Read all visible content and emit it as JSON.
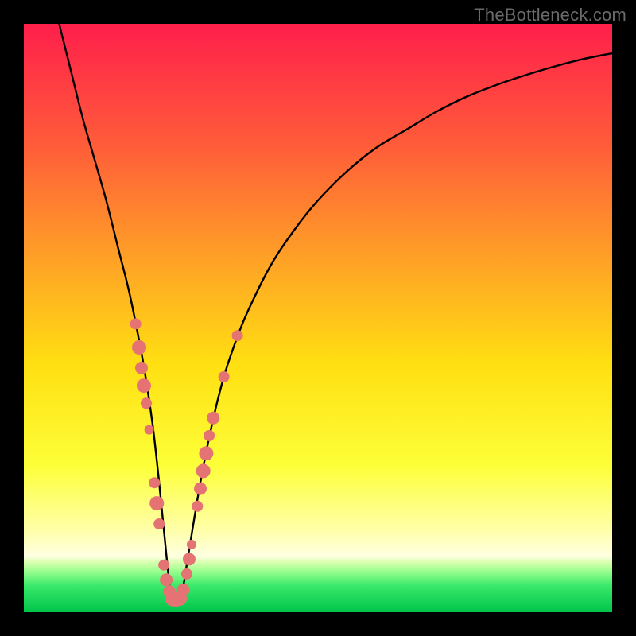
{
  "watermark": "TheBottleneck.com",
  "chart_data": {
    "type": "line",
    "title": "",
    "xlabel": "",
    "ylabel": "",
    "xlim": [
      0,
      100
    ],
    "ylim": [
      0,
      100
    ],
    "gradient_stops": [
      {
        "offset": 0.0,
        "color": "#ff1f4b"
      },
      {
        "offset": 0.2,
        "color": "#ff5a3a"
      },
      {
        "offset": 0.4,
        "color": "#ffa126"
      },
      {
        "offset": 0.58,
        "color": "#ffe012"
      },
      {
        "offset": 0.75,
        "color": "#fdff38"
      },
      {
        "offset": 0.86,
        "color": "#ffffa8"
      },
      {
        "offset": 0.905,
        "color": "#ffffe2"
      },
      {
        "offset": 0.915,
        "color": "#d9ffb0"
      },
      {
        "offset": 0.93,
        "color": "#9cff8e"
      },
      {
        "offset": 0.955,
        "color": "#39e96a"
      },
      {
        "offset": 1.0,
        "color": "#00c44a"
      }
    ],
    "series": [
      {
        "name": "bottleneck-curve",
        "x": [
          6,
          8,
          10,
          12,
          14,
          16,
          18,
          20,
          21,
          22,
          23,
          24,
          25,
          26,
          27,
          28,
          30,
          32,
          34,
          36,
          38,
          42,
          46,
          50,
          55,
          60,
          65,
          70,
          75,
          80,
          85,
          90,
          95,
          100
        ],
        "y": [
          100,
          92,
          84,
          77,
          70,
          62,
          54,
          44,
          38,
          31,
          22,
          12,
          3,
          2,
          4,
          10,
          22,
          32,
          40,
          46,
          51,
          59,
          65,
          70,
          75,
          79,
          82,
          85,
          87.5,
          89.5,
          91.2,
          92.7,
          94,
          95
        ]
      }
    ],
    "markers": {
      "name": "sample-points",
      "color": "#e57373",
      "radius_range": [
        5,
        10
      ],
      "points": [
        {
          "x": 19.0,
          "y": 49.0,
          "r": 7
        },
        {
          "x": 19.6,
          "y": 45.0,
          "r": 9
        },
        {
          "x": 20.0,
          "y": 41.5,
          "r": 8
        },
        {
          "x": 20.4,
          "y": 38.5,
          "r": 9
        },
        {
          "x": 20.8,
          "y": 35.5,
          "r": 7
        },
        {
          "x": 21.3,
          "y": 31.0,
          "r": 6
        },
        {
          "x": 22.2,
          "y": 22.0,
          "r": 7
        },
        {
          "x": 22.6,
          "y": 18.5,
          "r": 9
        },
        {
          "x": 23.0,
          "y": 15.0,
          "r": 7
        },
        {
          "x": 23.8,
          "y": 8.0,
          "r": 7
        },
        {
          "x": 24.2,
          "y": 5.5,
          "r": 8
        },
        {
          "x": 24.7,
          "y": 3.5,
          "r": 8
        },
        {
          "x": 25.3,
          "y": 2.2,
          "r": 9
        },
        {
          "x": 25.9,
          "y": 2.0,
          "r": 8
        },
        {
          "x": 26.5,
          "y": 2.3,
          "r": 9
        },
        {
          "x": 27.1,
          "y": 3.8,
          "r": 8
        },
        {
          "x": 27.7,
          "y": 6.5,
          "r": 7
        },
        {
          "x": 28.1,
          "y": 9.0,
          "r": 8
        },
        {
          "x": 28.5,
          "y": 11.5,
          "r": 6
        },
        {
          "x": 29.5,
          "y": 18.0,
          "r": 7
        },
        {
          "x": 30.0,
          "y": 21.0,
          "r": 8
        },
        {
          "x": 30.5,
          "y": 24.0,
          "r": 9
        },
        {
          "x": 31.0,
          "y": 27.0,
          "r": 9
        },
        {
          "x": 31.5,
          "y": 30.0,
          "r": 7
        },
        {
          "x": 32.2,
          "y": 33.0,
          "r": 8
        },
        {
          "x": 34.0,
          "y": 40.0,
          "r": 7
        },
        {
          "x": 36.3,
          "y": 47.0,
          "r": 7
        }
      ]
    }
  }
}
